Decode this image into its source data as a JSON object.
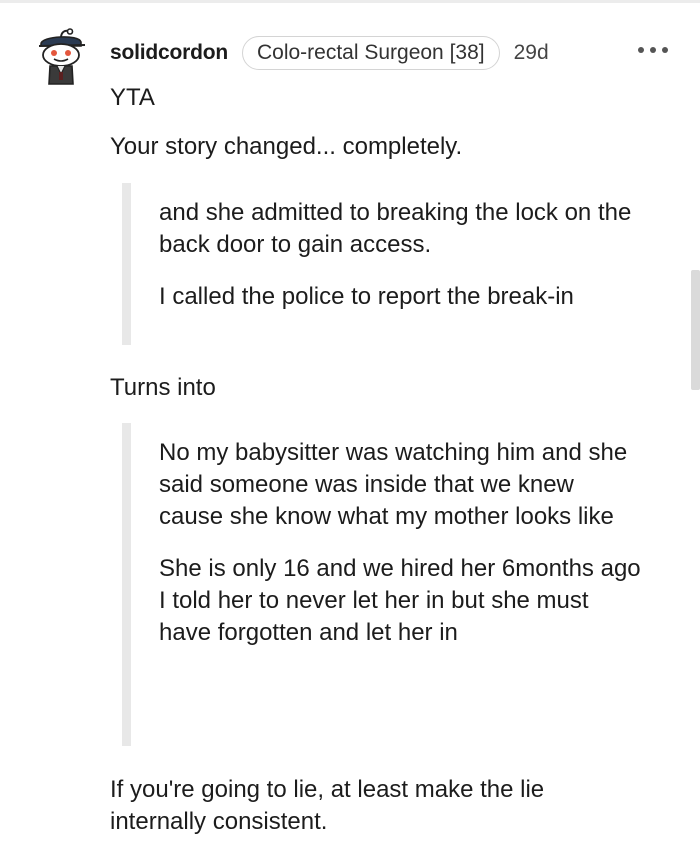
{
  "comment": {
    "username": "solidcordon",
    "flair": "Colo-rectal Surgeon [38]",
    "time": "29d",
    "verdict": "YTA",
    "intro": "Your story changed... completely.",
    "quote1": {
      "lines": [
        "and she admitted to breaking the lock on the back door to gain access.",
        "I called the police to report the break-in"
      ]
    },
    "transition": "Turns into",
    "quote2": {
      "lines": [
        "No my babysitter was watching him and she said someone was inside that we knew cause she know what my mother looks like",
        "She is only 16 and we hired her 6months ago I told her to never let her in but she must have forgotten and let her in"
      ]
    },
    "closing": "If you're going to lie, at least make the lie internally consistent."
  },
  "icons": {
    "avatar": "snoo-avatar",
    "more": "more-options-icon"
  }
}
